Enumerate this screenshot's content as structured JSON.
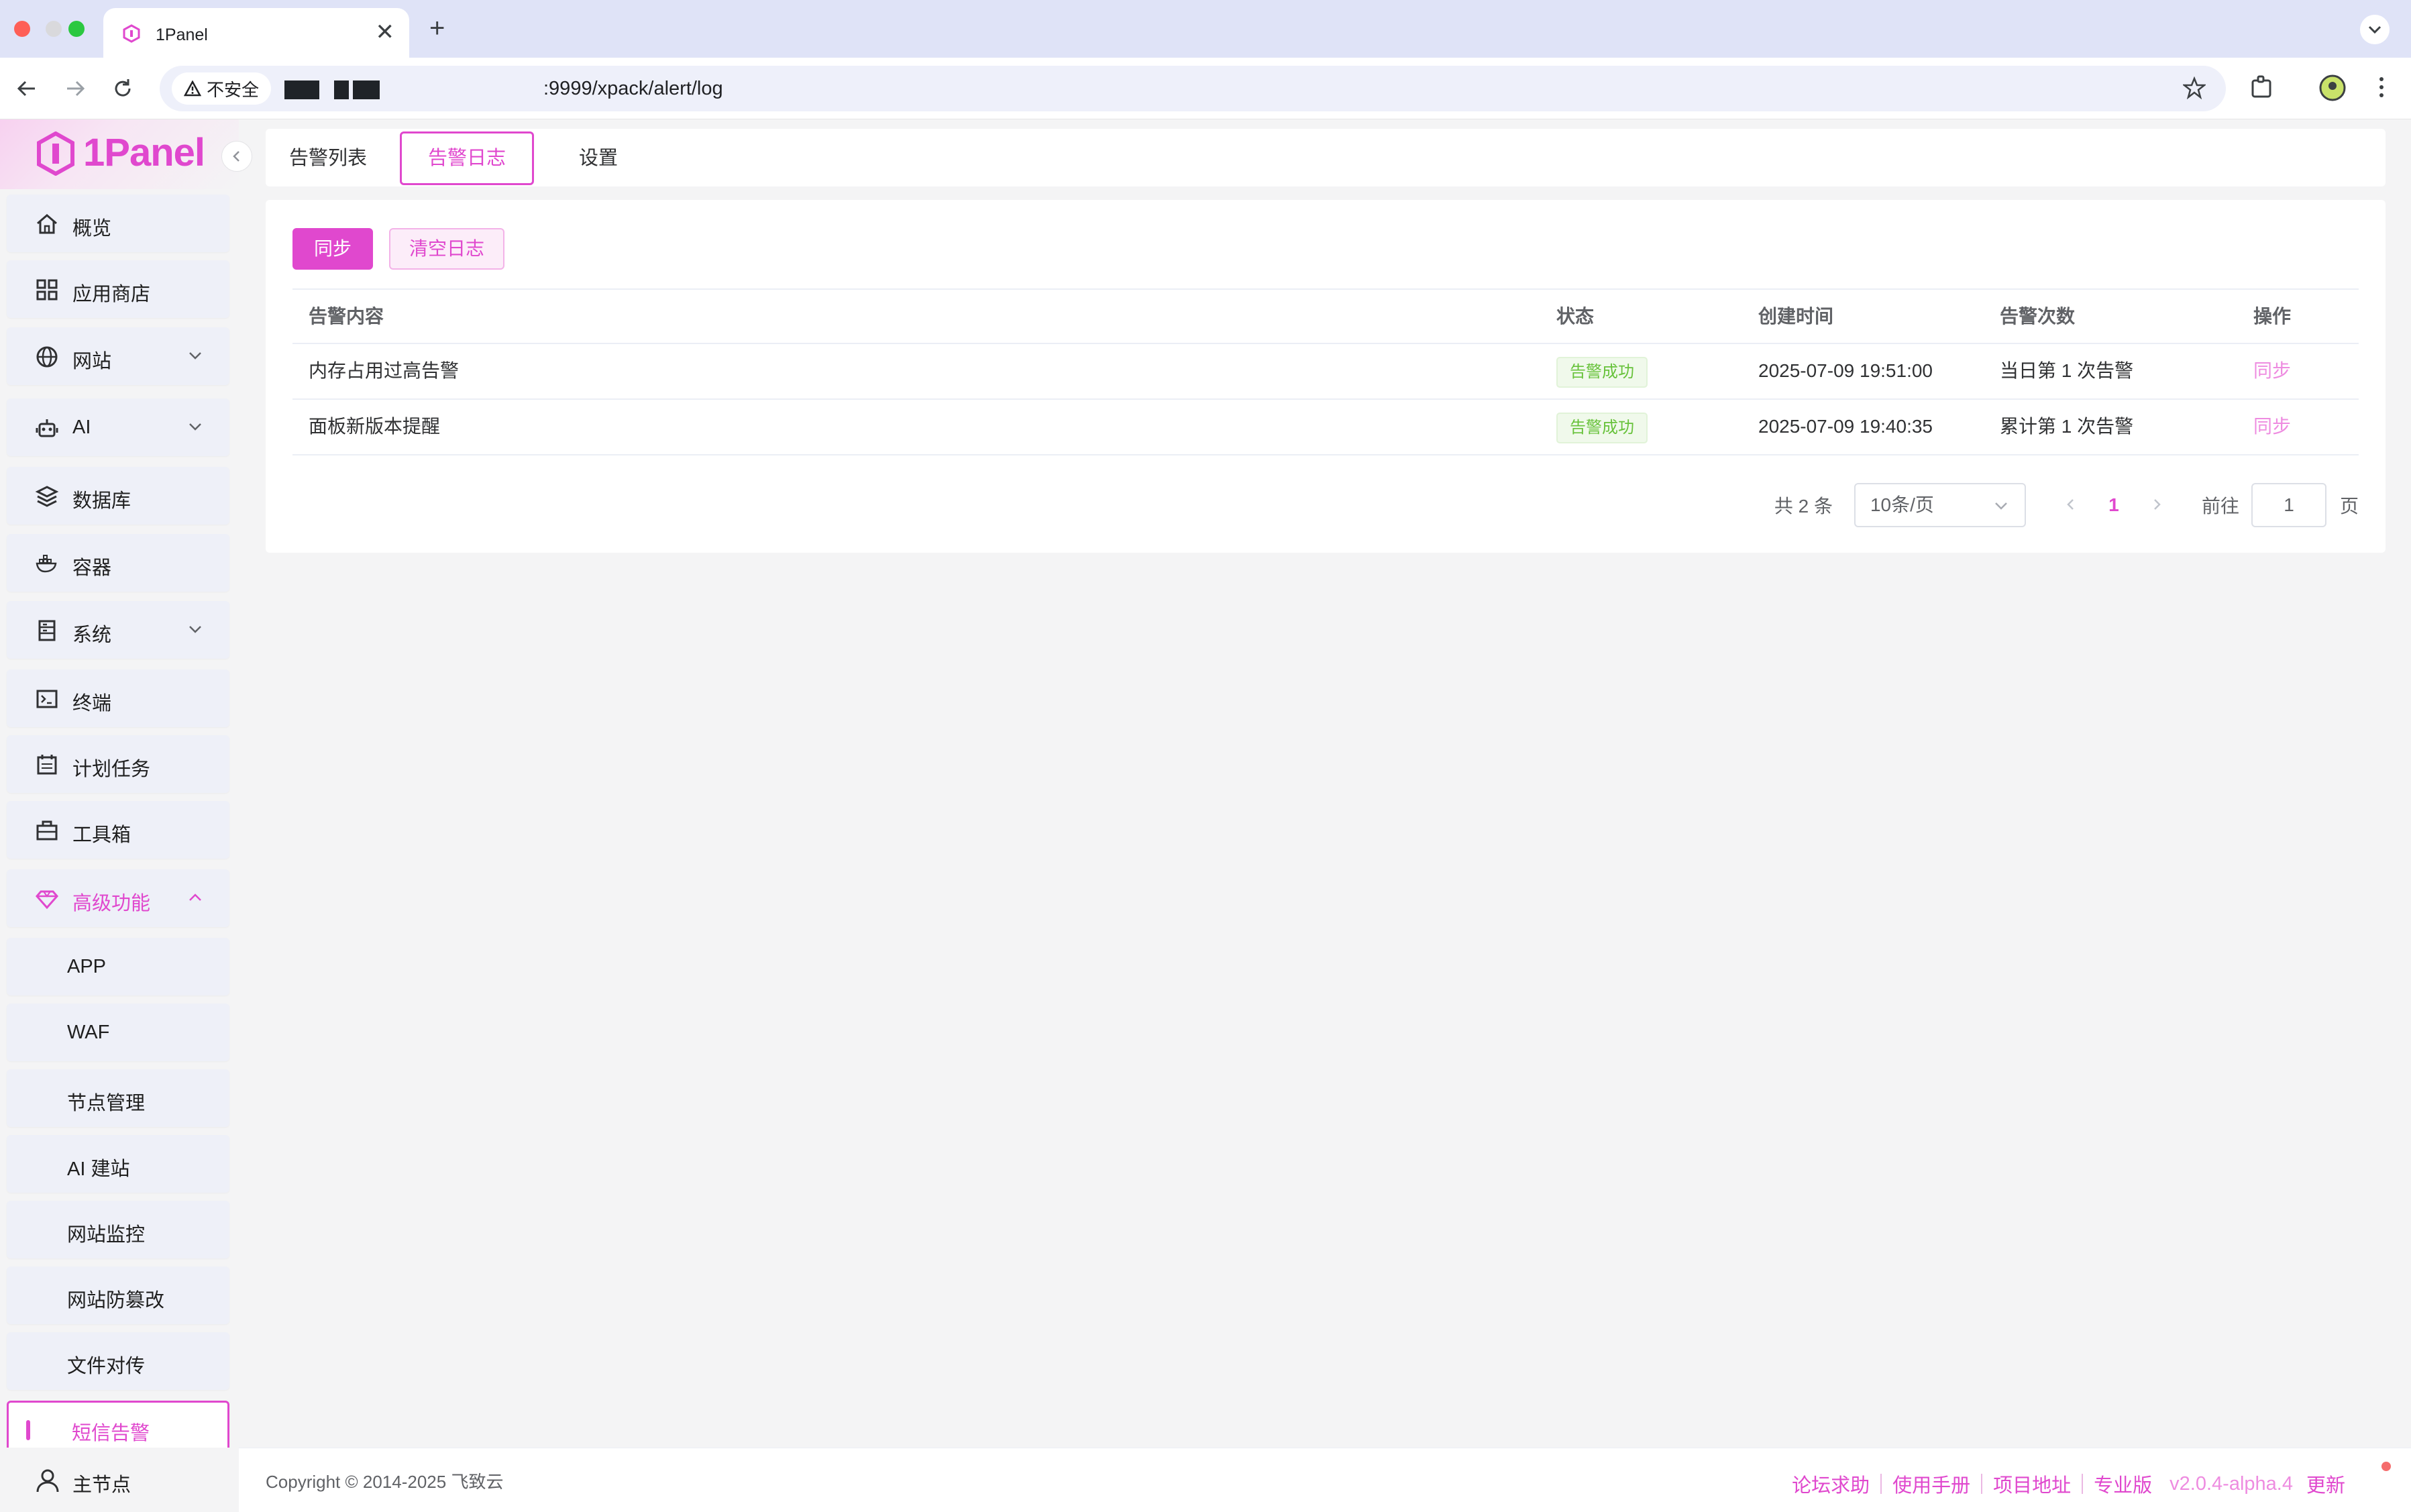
{
  "browser": {
    "tab_title": "1Panel",
    "close_glyph": "✕",
    "new_tab_glyph": "+",
    "security_label": "不安全",
    "url": ":9999/xpack/alert/log"
  },
  "brand": {
    "name": "1Panel",
    "accent": "#e048ce"
  },
  "sidebar": {
    "items": [
      {
        "label": "概览",
        "icon": "home-icon"
      },
      {
        "label": "应用商店",
        "icon": "grid-icon"
      },
      {
        "label": "网站",
        "icon": "globe-icon",
        "expandable": true
      },
      {
        "label": "AI",
        "icon": "robot-icon",
        "expandable": true
      },
      {
        "label": "数据库",
        "icon": "layers-icon"
      },
      {
        "label": "容器",
        "icon": "docker-icon"
      },
      {
        "label": "系统",
        "icon": "server-icon",
        "expandable": true
      },
      {
        "label": "终端",
        "icon": "terminal-icon"
      },
      {
        "label": "计划任务",
        "icon": "calendar-icon"
      },
      {
        "label": "工具箱",
        "icon": "toolbox-icon"
      },
      {
        "label": "高级功能",
        "icon": "diamond-icon",
        "expanded": true
      }
    ],
    "sub_items": [
      "APP",
      "WAF",
      "节点管理",
      "AI 建站",
      "网站监控",
      "网站防篡改",
      "文件对传"
    ],
    "selected_item": "短信告警",
    "node": "主节点"
  },
  "tabs": [
    "告警列表",
    "告警日志",
    "设置"
  ],
  "active_tab": "告警日志",
  "toolbar": {
    "sync_label": "同步",
    "clear_label": "清空日志"
  },
  "table": {
    "headers": {
      "content": "告警内容",
      "status": "状态",
      "time": "创建时间",
      "count": "告警次数",
      "op": "操作"
    },
    "rows": [
      {
        "content": "内存占用过高告警",
        "status": "告警成功",
        "time": "2025-07-09 19:51:00",
        "count": "当日第 1 次告警",
        "op": "同步"
      },
      {
        "content": "面板新版本提醒",
        "status": "告警成功",
        "time": "2025-07-09 19:40:35",
        "count": "累计第 1 次告警",
        "op": "同步"
      }
    ]
  },
  "pagination": {
    "total": "共 2 条",
    "page_size": "10条/页",
    "current": "1",
    "goto_label": "前往",
    "goto_value": "1",
    "page_suffix": "页"
  },
  "footer": {
    "copyright": "Copyright © 2014-2025 飞致云",
    "links": [
      "论坛求助",
      "使用手册",
      "项目地址",
      "专业版"
    ],
    "version": "v2.0.4-alpha.4",
    "update": "更新"
  }
}
